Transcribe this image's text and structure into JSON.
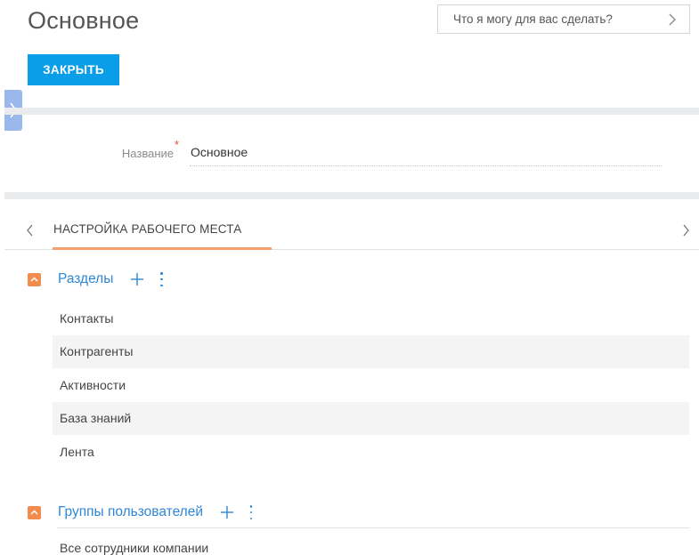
{
  "header": {
    "title": "Основное",
    "search_placeholder": "Что я могу для вас сделать?",
    "close_label": "ЗАКРЫТЬ"
  },
  "form": {
    "name_label": "Название",
    "required_mark": "*",
    "name_value": "Основное"
  },
  "tabs": [
    {
      "label": "НАСТРОЙКА РАБОЧЕГО МЕСТА",
      "active": true
    }
  ],
  "sections_group": {
    "title": "Разделы",
    "items": [
      "Контакты",
      "Контрагенты",
      "Активности",
      "База знаний",
      "Лента"
    ]
  },
  "user_groups": {
    "title": "Группы пользователей",
    "items": [
      "Все сотрудники компании"
    ]
  },
  "colors": {
    "accent_blue": "#0a9ee8",
    "link_blue": "#2d86d6",
    "orange": "#f28c4e",
    "tab_underline": "#f4a16b",
    "required_red": "#e64c3c"
  }
}
